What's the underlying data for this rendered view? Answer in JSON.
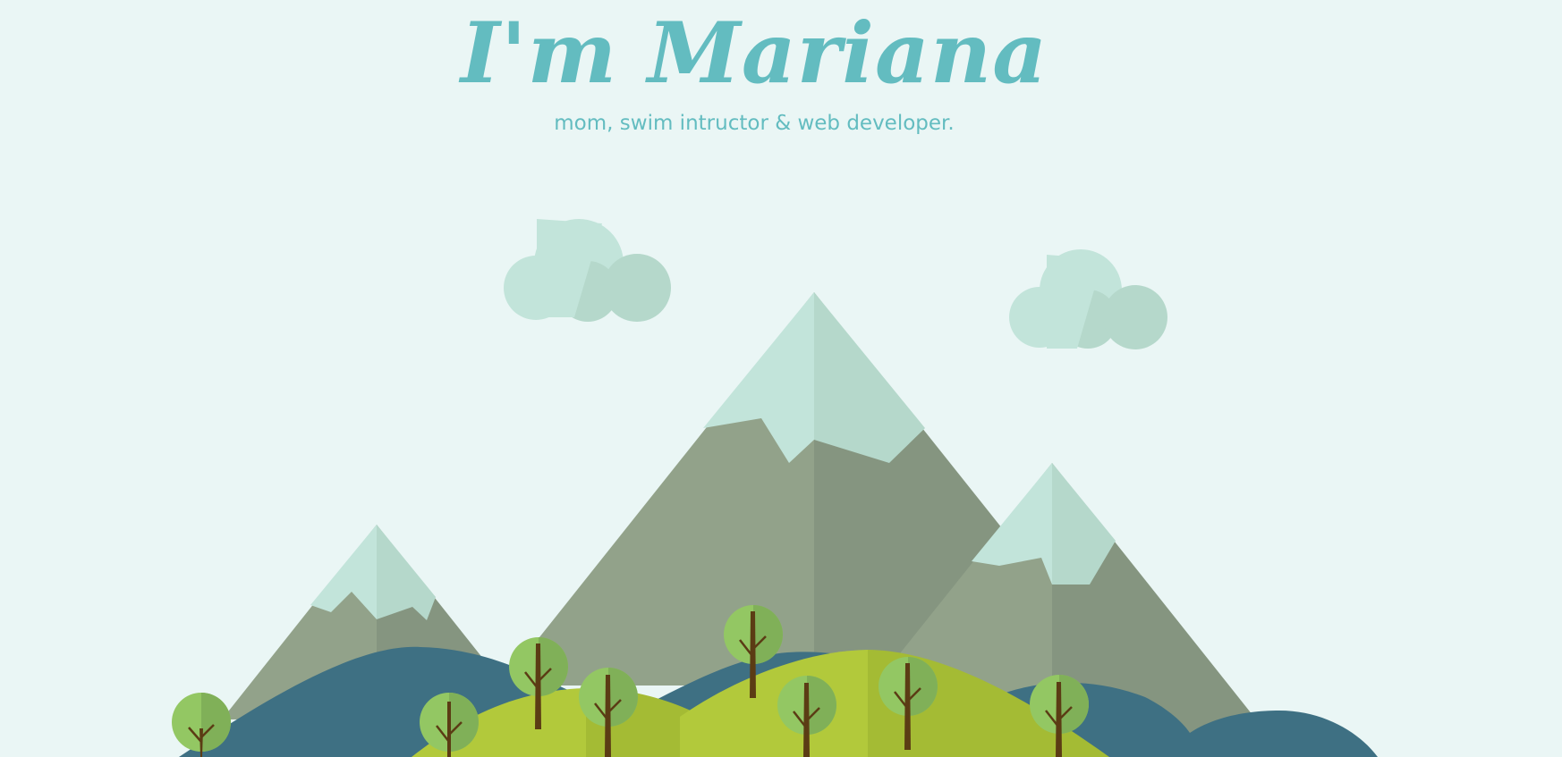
{
  "hero": {
    "title": "I'm Mariana",
    "subtitle": "mom, swim intructor & web developer."
  },
  "colors": {
    "background": "#eaf6f5",
    "accent_text": "#63bcc0",
    "snow_light": "#c2e4da",
    "snow_shade": "#b5d8cb",
    "mountain_light": "#92a28a",
    "mountain_shade": "#859580",
    "hill_blue": "#3e7083",
    "hill_green_light": "#b2c93b",
    "hill_green_shade": "#a4bb34",
    "tree_leaf_light": "#93c763",
    "tree_leaf_shade": "#80b058",
    "tree_trunk": "#5b3c14"
  },
  "icons": {
    "clouds": "cloud-icon",
    "mountains": "mountain-icon",
    "trees": "tree-icon"
  }
}
